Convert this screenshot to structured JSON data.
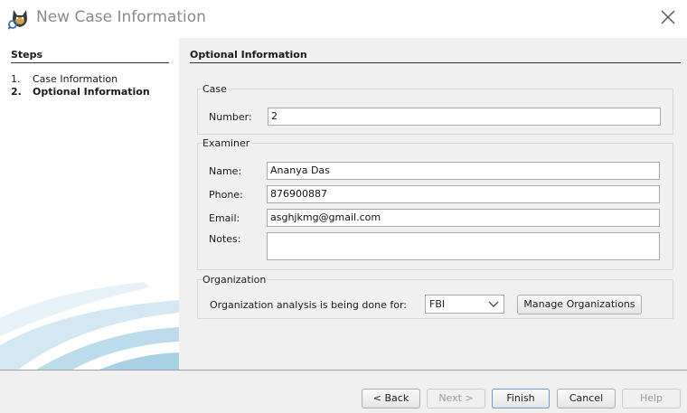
{
  "window": {
    "title": "New Case Information",
    "app_icon": "autopsy-dog-icon",
    "close_icon": "close-icon"
  },
  "steps": {
    "heading": "Steps",
    "items": [
      {
        "num": "1.",
        "label": "Case Information",
        "current": false
      },
      {
        "num": "2.",
        "label": "Optional Information",
        "current": true
      }
    ]
  },
  "panel": {
    "heading": "Optional Information",
    "case": {
      "group_label": "Case",
      "number_label": "Number:",
      "number_value": "2"
    },
    "examiner": {
      "group_label": "Examiner",
      "name_label": "Name:",
      "name_value": "Ananya Das",
      "phone_label": "Phone:",
      "phone_value": "876900887",
      "email_label": "Email:",
      "email_value": "asghjkmg@gmail.com",
      "notes_label": "Notes:",
      "notes_value": ""
    },
    "organization": {
      "group_label": "Organization",
      "analysis_label": "Organization analysis is being done for:",
      "selected_org": "FBI",
      "manage_button": "Manage Organizations"
    }
  },
  "footer": {
    "back": "< Back",
    "next": "Next >",
    "finish": "Finish",
    "cancel": "Cancel",
    "help": "Help"
  }
}
